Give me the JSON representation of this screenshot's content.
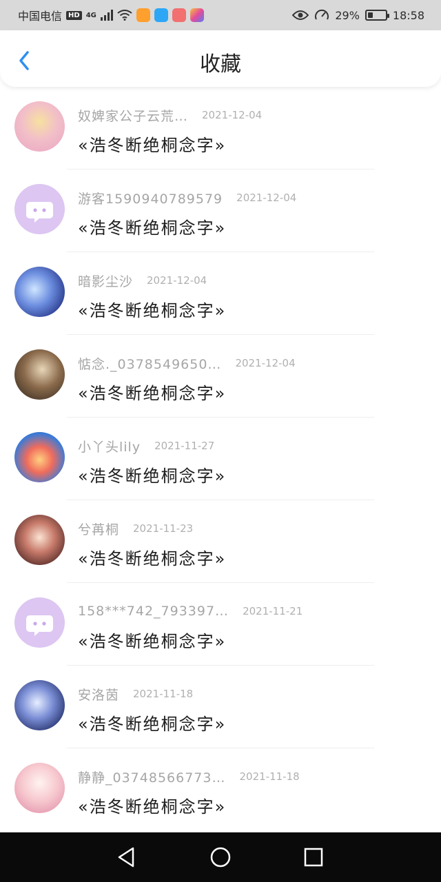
{
  "status_bar": {
    "carrier": "中国电信",
    "hd": "HD",
    "network": "4G",
    "battery": "29%",
    "battery_level": 0.29,
    "time": "18:58"
  },
  "header": {
    "title": "收藏"
  },
  "favorites": [
    {
      "user": "奴婢家公子云荒…",
      "date": "2021-12-04",
      "content": "«浩冬断绝桐念字»"
    },
    {
      "user": "游客1590940789579",
      "date": "2021-12-04",
      "content": "«浩冬断绝桐念字»"
    },
    {
      "user": "暗影尘沙",
      "date": "2021-12-04",
      "content": "«浩冬断绝桐念字»"
    },
    {
      "user": "惦念._0378549650…",
      "date": "2021-12-04",
      "content": "«浩冬断绝桐念字»"
    },
    {
      "user": "小丫头lily",
      "date": "2021-11-27",
      "content": "«浩冬断绝桐念字»"
    },
    {
      "user": "兮苒桐",
      "date": "2021-11-23",
      "content": "«浩冬断绝桐念字»"
    },
    {
      "user": "158***742_793397…",
      "date": "2021-11-21",
      "content": "«浩冬断绝桐念字»"
    },
    {
      "user": "安洛茵",
      "date": "2021-11-18",
      "content": "«浩冬断绝桐念字»"
    },
    {
      "user": "静静_03748566773…",
      "date": "2021-11-18",
      "content": "«浩冬断绝桐念字»"
    }
  ],
  "colors": {
    "accent": "#2f8ff0",
    "default_avatar": "#ddc6f2"
  }
}
